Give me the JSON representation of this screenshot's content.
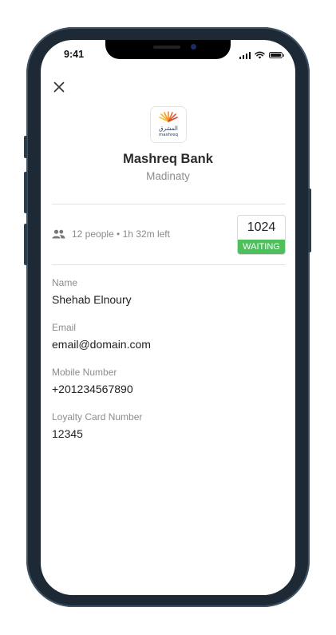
{
  "status_bar": {
    "time": "9:41"
  },
  "bank": {
    "name": "Mashreq Bank",
    "branch": "Madinaty",
    "logo_text_ar": "المشرق",
    "logo_text_en": "mashreq"
  },
  "queue": {
    "people_info": "12 people • 1h 32m left"
  },
  "ticket": {
    "number": "1024",
    "status": "WAITING"
  },
  "fields": [
    {
      "label": "Name",
      "value": "Shehab Elnoury"
    },
    {
      "label": "Email",
      "value": "email@domain.com"
    },
    {
      "label": "Mobile Number",
      "value": "+201234567890"
    },
    {
      "label": "Loyalty Card Number",
      "value": "12345"
    }
  ],
  "colors": {
    "status_waiting": "#4fbf5e",
    "brand_orange": "#f28c28",
    "brand_blue": "#1f3a6e"
  },
  "icons": {
    "close": "close-icon",
    "people": "people-icon"
  }
}
